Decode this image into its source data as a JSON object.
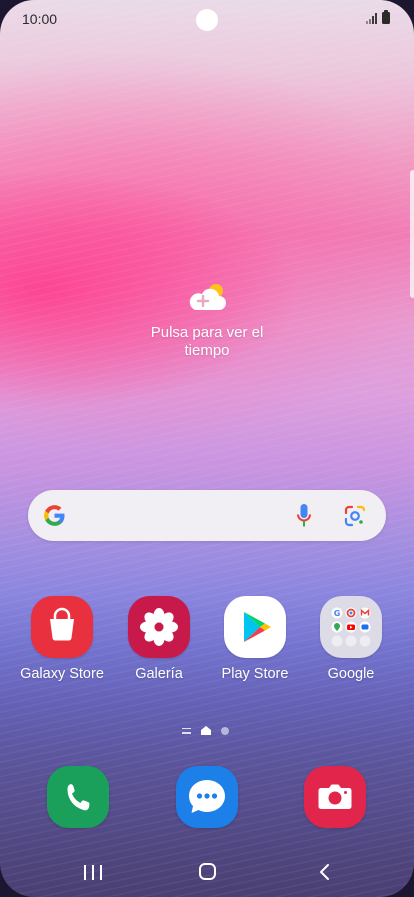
{
  "status_bar": {
    "time": "10:00"
  },
  "weather_widget": {
    "text": "Pulsa para ver el tiempo",
    "icon": "cloud-plus-sun-icon"
  },
  "search_bar": {
    "logo_icon": "google-g-icon",
    "mic_icon": "microphone-icon",
    "lens_icon": "google-lens-icon"
  },
  "apps": [
    {
      "label": "Galaxy Store",
      "icon": "galaxy-store-icon",
      "color": "#e8303f"
    },
    {
      "label": "Galería",
      "icon": "gallery-icon",
      "color": "#c8194b"
    },
    {
      "label": "Play Store",
      "icon": "play-store-icon",
      "color": "#ffffff"
    },
    {
      "label": "Google",
      "icon": "google-folder-icon",
      "color": "#dcdbe6"
    }
  ],
  "dock": [
    {
      "icon": "phone-icon",
      "color": "#1aa05a"
    },
    {
      "icon": "messages-icon",
      "color": "#1d7fe8"
    },
    {
      "icon": "camera-icon",
      "color": "#e2254a"
    }
  ],
  "page_indicator": {
    "current_page": 1,
    "total_pages": 2
  },
  "nav_bar": {
    "recents_icon": "recents-icon",
    "home_icon": "home-icon",
    "back_icon": "back-icon"
  }
}
